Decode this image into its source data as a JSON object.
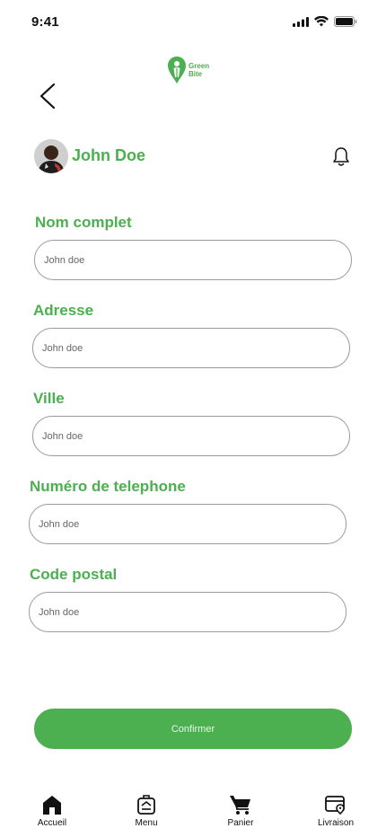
{
  "status_bar": {
    "time": "9:41"
  },
  "brand": {
    "line1": "Green",
    "line2": "Bite",
    "color": "#4caf50"
  },
  "profile": {
    "name": "John Doe"
  },
  "form": {
    "fields": [
      {
        "label": "Nom complet",
        "placeholder": "John doe"
      },
      {
        "label": "Adresse",
        "placeholder": "John doe"
      },
      {
        "label": "Ville",
        "placeholder": "John doe"
      },
      {
        "label": "Numéro de telephone",
        "placeholder": "John doe"
      },
      {
        "label": "Code postal",
        "placeholder": "John doe"
      }
    ],
    "confirm_label": "Confirmer"
  },
  "bottom_nav": {
    "items": [
      {
        "label": "Accueil",
        "icon": "home-icon"
      },
      {
        "label": "Menu",
        "icon": "menu-icon"
      },
      {
        "label": "Panier",
        "icon": "cart-icon"
      },
      {
        "label": "Livraison",
        "icon": "delivery-icon"
      }
    ]
  }
}
